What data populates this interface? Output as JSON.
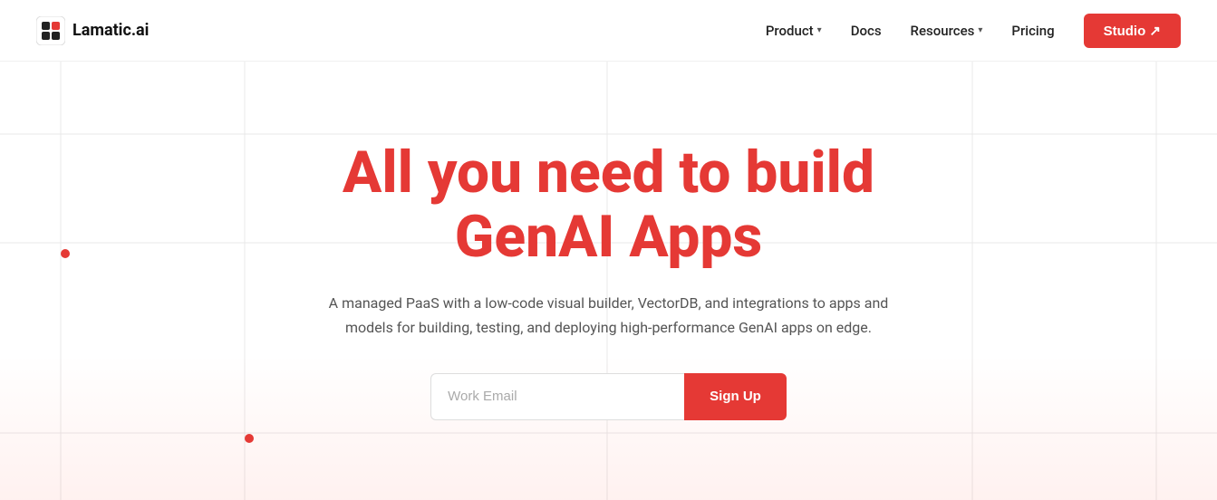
{
  "logo": {
    "text": "Lamatic.ai"
  },
  "nav": {
    "product_label": "Product",
    "docs_label": "Docs",
    "resources_label": "Resources",
    "pricing_label": "Pricing",
    "studio_label": "Studio ↗"
  },
  "hero": {
    "title_line1": "All you need to build",
    "title_line2": "GenAI Apps",
    "subtitle": "A managed PaaS with a low-code visual builder, VectorDB, and integrations to apps and models for building, testing, and deploying high-performance GenAI apps on edge.",
    "email_placeholder": "Work Email",
    "signup_label": "Sign Up"
  },
  "colors": {
    "accent": "#e53935",
    "text_primary": "#111",
    "text_muted": "#555"
  }
}
